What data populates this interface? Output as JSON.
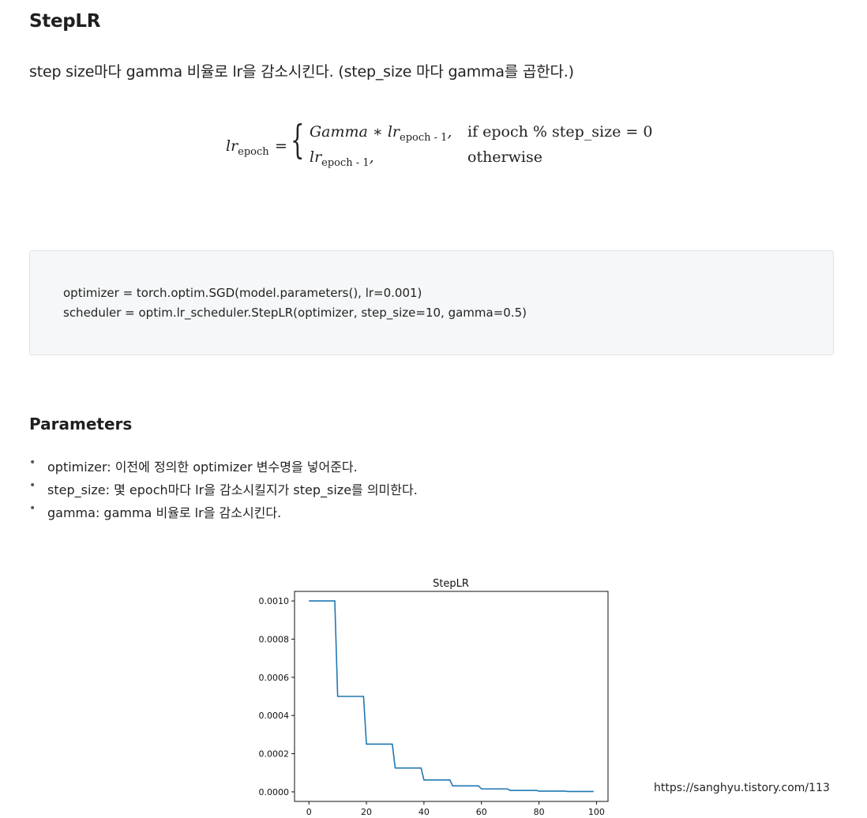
{
  "heading": "StepLR",
  "lead": "step size마다 gamma 비율로 lr을 감소시킨다. (step_size 마다 gamma를 곱한다.)",
  "formula": {
    "lhs": "lr",
    "lhs_sub": "epoch",
    "case1": "Gamma ∗ lr",
    "case1_sub": "epoch - 1",
    "case1_tail": ",",
    "case2": "lr",
    "case2_sub": "epoch - 1",
    "case2_tail": ",",
    "cond1": "if epoch % step_size = 0",
    "cond2": "otherwise"
  },
  "code": {
    "line1": "optimizer = torch.optim.SGD(model.parameters(), lr=0.001)",
    "line2": "scheduler = optim.lr_scheduler.StepLR(optimizer, step_size=10, gamma=0.5)"
  },
  "parameters_heading": "Parameters",
  "bullets": [
    "optimizer: 이전에 정의한 optimizer 변수명을 넣어준다.",
    "step_size: 몇 epoch마다 lr을 감소시킬지가 step_size를 의미한다.",
    "gamma: gamma 비율로 lr을 감소시킨다."
  ],
  "source": "https://sanghyu.tistory.com/113",
  "chart_data": {
    "type": "line",
    "title": "StepLR",
    "xlabel": "",
    "ylabel": "",
    "xlim": [
      -5,
      104
    ],
    "ylim": [
      -5e-05,
      0.00105
    ],
    "xticks": [
      0,
      20,
      40,
      60,
      80,
      100
    ],
    "yticks": [
      "0.0000",
      "0.0002",
      "0.0004",
      "0.0006",
      "0.0008",
      "0.0010"
    ],
    "grid": false,
    "line_color": "#1f77b4",
    "x": [
      0,
      9,
      10,
      19,
      20,
      29,
      30,
      39,
      40,
      49,
      50,
      59,
      60,
      69,
      70,
      79,
      80,
      89,
      90,
      99
    ],
    "y": [
      0.001,
      0.001,
      0.0005,
      0.0005,
      0.00025,
      0.00025,
      0.000125,
      0.000125,
      6.25e-05,
      6.25e-05,
      3.125e-05,
      3.125e-05,
      1.5625e-05,
      1.5625e-05,
      7.8125e-06,
      7.8125e-06,
      3.90625e-06,
      3.90625e-06,
      1.953125e-06,
      1.953125e-06
    ]
  }
}
